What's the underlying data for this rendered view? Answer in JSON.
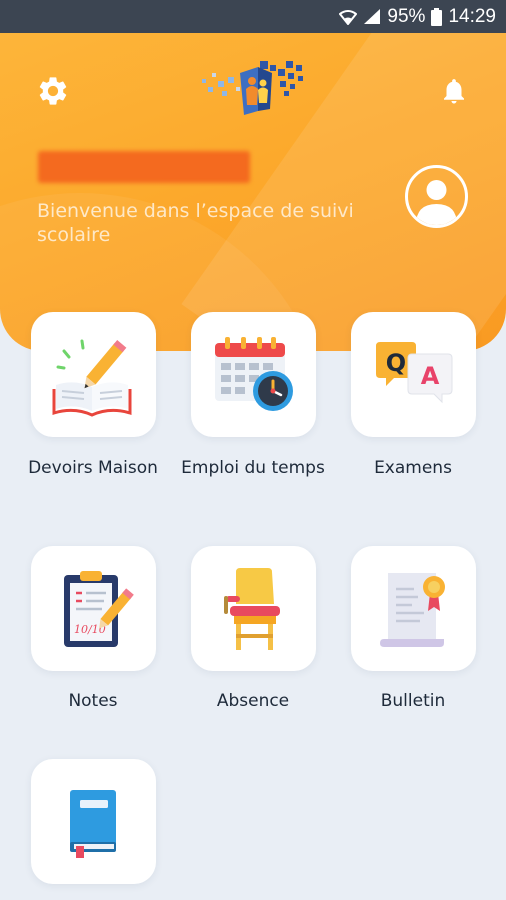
{
  "status_bar": {
    "battery_percent": "95%",
    "time": "14:29"
  },
  "header": {
    "welcome_text": "Bienvenue dans l’espace de suivi scolaire",
    "settings_icon": "gear-icon",
    "notification_icon": "bell-icon",
    "avatar_icon": "user-avatar-icon",
    "accent_color": "#fca92c"
  },
  "menu": {
    "items": [
      {
        "label": "Devoirs Maison",
        "icon": "homework-book-icon"
      },
      {
        "label": "Emploi du temps",
        "icon": "calendar-clock-icon"
      },
      {
        "label": "Examens",
        "icon": "qa-icon"
      },
      {
        "label": "Notes",
        "icon": "clipboard-grade-icon"
      },
      {
        "label": "Absence",
        "icon": "chair-icon"
      },
      {
        "label": "Bulletin",
        "icon": "certificate-icon"
      },
      {
        "label": "",
        "icon": "blue-book-icon"
      }
    ]
  }
}
